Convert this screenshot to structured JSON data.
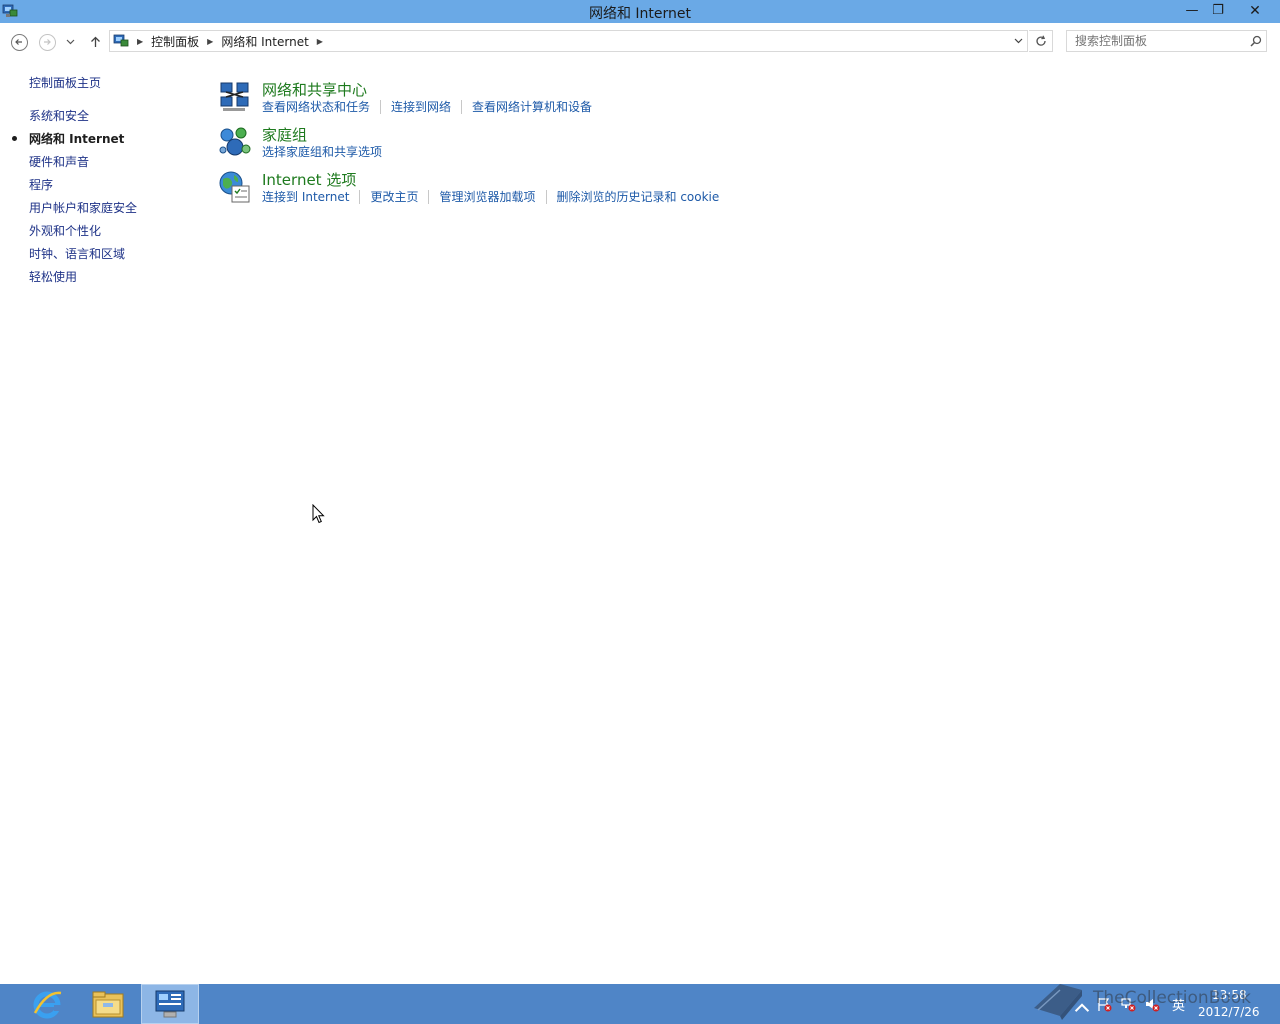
{
  "window": {
    "title": "网络和 Internet",
    "minimize_glyph": "—",
    "maximize_glyph": "❐",
    "close_glyph": "✕"
  },
  "navigation": {
    "back_icon": "back-arrow-icon",
    "forward_icon": "forward-arrow-icon",
    "recent_icon": "chevron-down-icon",
    "up_icon": "up-arrow-icon",
    "breadcrumbs": [
      "控制面板",
      "网络和 Internet"
    ],
    "refresh_icon": "refresh-icon",
    "search_placeholder": "搜索控制面板"
  },
  "sidebar": {
    "home": "控制面板主页",
    "items": [
      {
        "label": "系统和安全",
        "current": false
      },
      {
        "label": "网络和 Internet",
        "current": true
      },
      {
        "label": "硬件和声音",
        "current": false
      },
      {
        "label": "程序",
        "current": false
      },
      {
        "label": "用户帐户和家庭安全",
        "current": false
      },
      {
        "label": "外观和个性化",
        "current": false
      },
      {
        "label": "时钟、语言和区域",
        "current": false
      },
      {
        "label": "轻松使用",
        "current": false
      }
    ]
  },
  "categories": [
    {
      "title": "网络和共享中心",
      "icon": "network-sharing-center-icon",
      "links": [
        "查看网络状态和任务",
        "连接到网络",
        "查看网络计算机和设备"
      ]
    },
    {
      "title": "家庭组",
      "icon": "homegroup-icon",
      "links": [
        "选择家庭组和共享选项"
      ]
    },
    {
      "title": "Internet 选项",
      "icon": "internet-options-icon",
      "links": [
        "连接到 Internet",
        "更改主页",
        "管理浏览器加载项",
        "删除浏览的历史记录和 cookie"
      ]
    }
  ],
  "taskbar": {
    "apps": [
      "internet-explorer-icon",
      "file-explorer-icon",
      "control-panel-icon"
    ],
    "ime": "英",
    "time": "13:58",
    "date": "2012/7/26"
  },
  "watermark": "TheCollectionBook",
  "colors": {
    "titlebar": "#6aa9e6",
    "taskbar": "#4f85c7",
    "link": "#1e5aa8",
    "category_heading": "#1e7a1e"
  }
}
